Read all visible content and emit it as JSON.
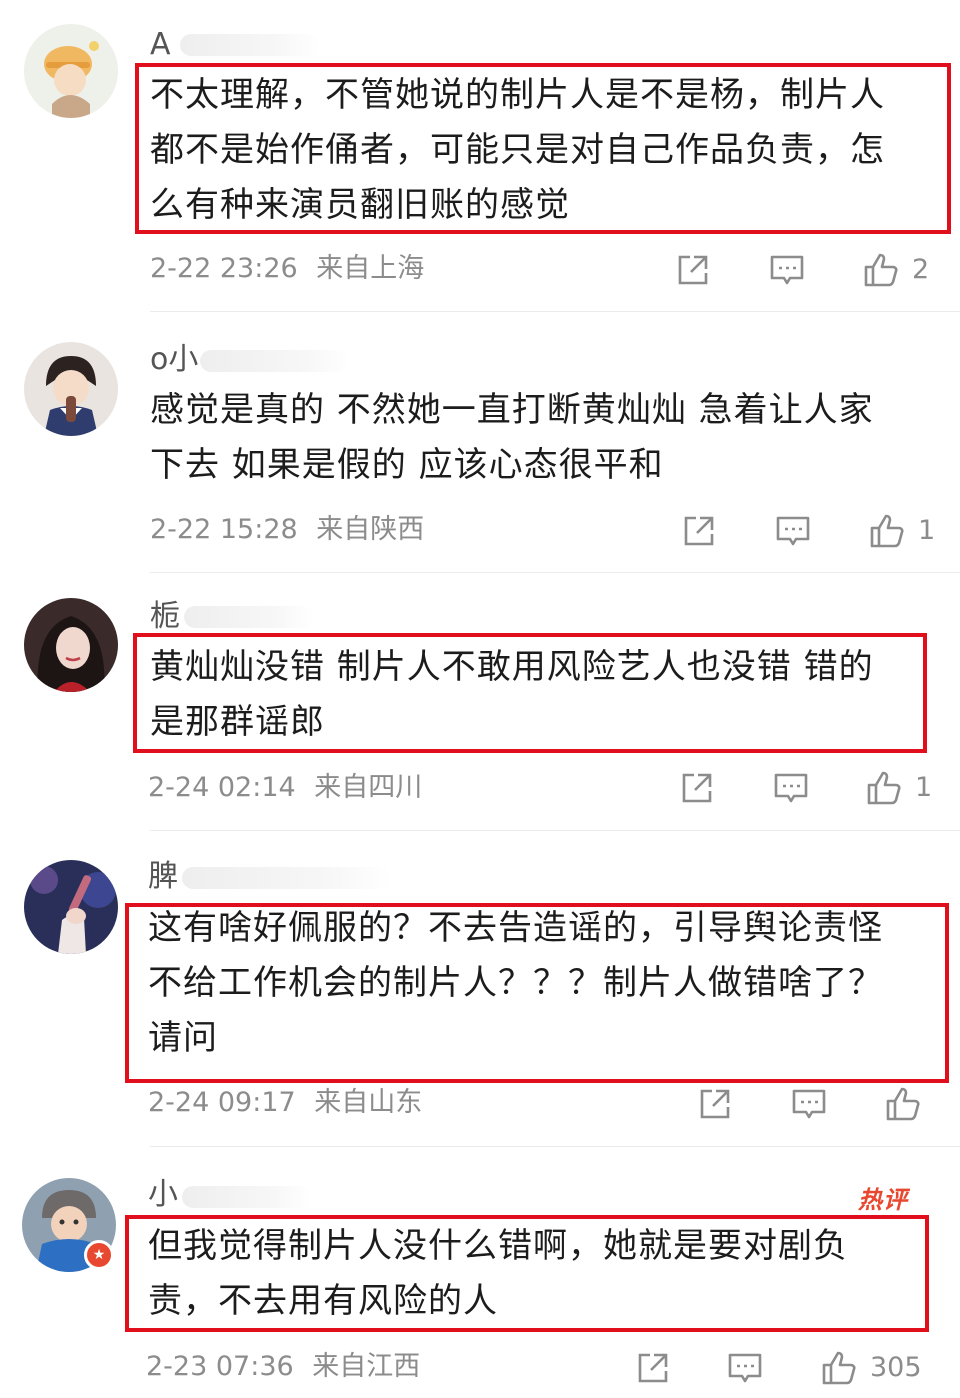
{
  "colors": {
    "accent_red": "#e10e1c",
    "meta_gray": "#8c8c8c",
    "text": "#1c1c1c",
    "hot_badge": "#e8482f"
  },
  "icons": {
    "share": "share-icon",
    "reply": "comment-icon",
    "like": "thumbs-up-icon"
  },
  "comments": [
    {
      "username": "A",
      "lines": [
        "不太理解，不管她说的制片人是不是杨，制片人",
        "都不是始作俑者，可能只是对自己作品负责，怎",
        "么有种来演员翻旧账的感觉"
      ],
      "time": "2-22 23:26",
      "location": "来自上海",
      "likes": "2",
      "highlighted": true
    },
    {
      "username": "o小",
      "lines": [
        "感觉是真的 不然她一直打断黄灿灿 急着让人家",
        "下去 如果是假的 应该心态很平和"
      ],
      "time": "2-22 15:28",
      "location": "来自陕西",
      "likes": "1",
      "highlighted": false
    },
    {
      "username": "栀",
      "lines": [
        "黄灿灿没错 制片人不敢用风险艺人也没错 错的",
        "是那群谣郎"
      ],
      "time": "2-24 02:14",
      "location": "来自四川",
      "likes": "1",
      "highlighted": true
    },
    {
      "username": "脾",
      "lines": [
        "这有啥好佩服的？不去告造谣的，引导舆论责怪",
        "不给工作机会的制片人？？？制片人做错啥了？",
        "请问"
      ],
      "time": "2-24 09:17",
      "location": "来自山东",
      "likes": "",
      "highlighted": true
    },
    {
      "username": "小",
      "lines": [
        "但我觉得制片人没什么错啊，她就是要对剧负",
        "责，不去用有风险的人"
      ],
      "time": "2-23 07:36",
      "location": "来自江西",
      "likes": "305",
      "highlighted": true,
      "badge": "热评"
    }
  ]
}
